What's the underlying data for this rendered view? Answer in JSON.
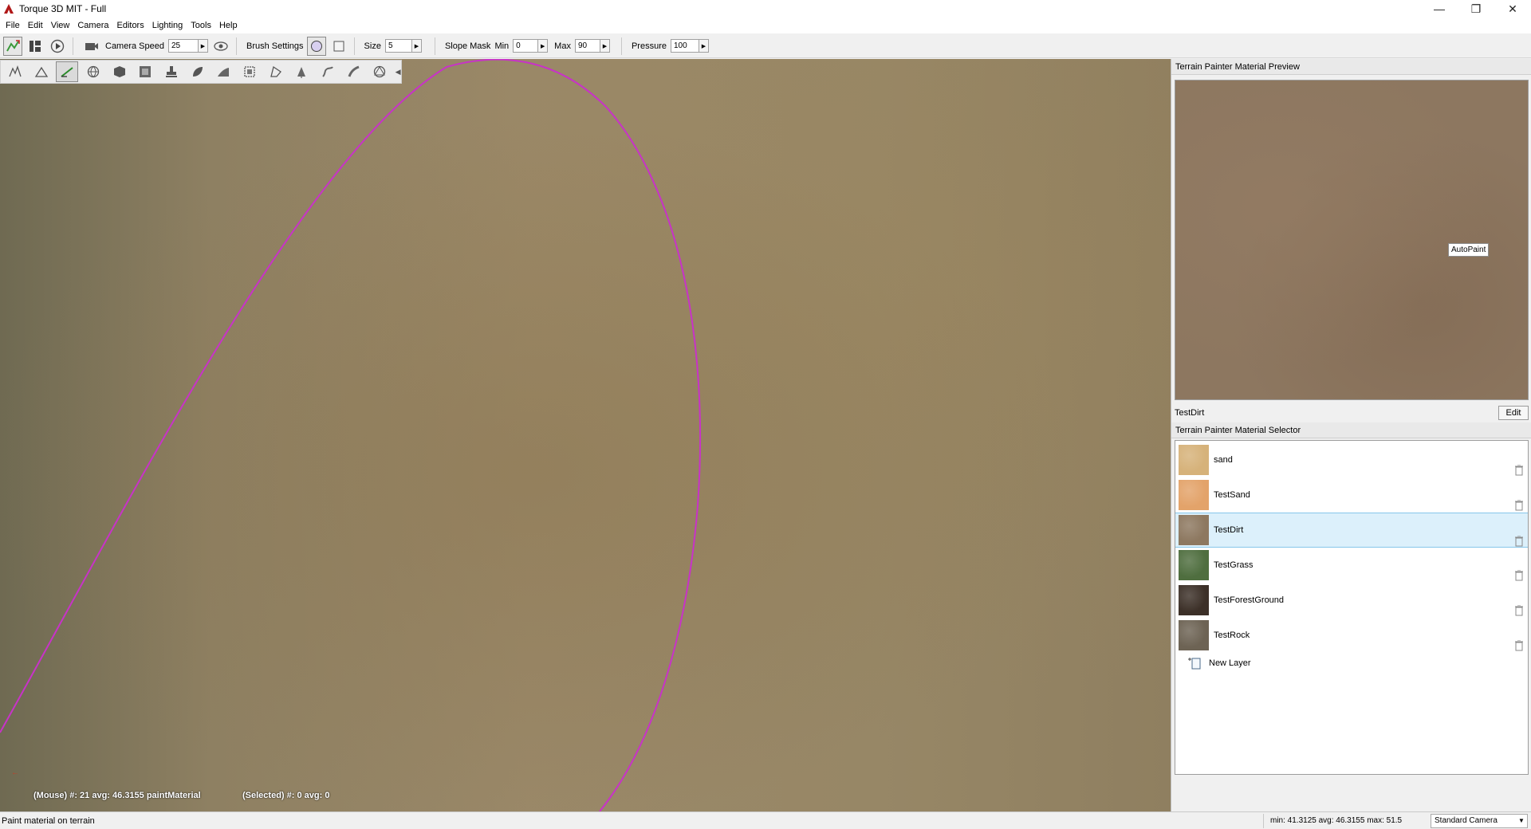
{
  "window": {
    "title": "Torque 3D MIT - Full",
    "controls": [
      "minimize",
      "maximize",
      "close"
    ]
  },
  "menu": [
    "File",
    "Edit",
    "View",
    "Camera",
    "Editors",
    "Lighting",
    "Tools",
    "Help"
  ],
  "toolbar": {
    "camera_speed_label": "Camera Speed",
    "camera_speed_value": "25",
    "brush_settings_label": "Brush Settings",
    "size_label": "Size",
    "size_value": "5",
    "slope_mask_label": "Slope Mask",
    "min_label": "Min",
    "min_value": "0",
    "max_label": "Max",
    "max_value": "90",
    "pressure_label": "Pressure",
    "pressure_value": "100"
  },
  "palette": {
    "tools": [
      "terrain-raise-icon",
      "terrain-height-icon",
      "terrain-paint-icon",
      "globe-icon",
      "cube-icon",
      "texture-icon",
      "stamp-icon",
      "leaf-icon",
      "ramp-icon",
      "bounds-icon",
      "shape-icon",
      "forest-icon",
      "river-icon",
      "road-icon",
      "navmesh-icon"
    ],
    "active_index": 2
  },
  "viewport": {
    "mouse_info": "(Mouse) #: 21  avg: 46.3155 paintMaterial",
    "selected_info": "(Selected) #: 0  avg: 0"
  },
  "preview_panel": {
    "title": "Terrain Painter Material Preview",
    "autopaint_label": "AutoPaint",
    "material_name": "TestDirt",
    "edit_label": "Edit"
  },
  "selector_panel": {
    "title": "Terrain Painter Material Selector",
    "materials": [
      {
        "name": "sand",
        "color": "#d6b27a"
      },
      {
        "name": "TestSand",
        "color": "#e3a36a"
      },
      {
        "name": "TestDirt",
        "color": "#8d7860"
      },
      {
        "name": "TestGrass",
        "color": "#4f6e3f"
      },
      {
        "name": "TestForestGround",
        "color": "#3c3028"
      },
      {
        "name": "TestRock",
        "color": "#6d6354"
      }
    ],
    "selected_index": 2,
    "new_layer_label": "New Layer"
  },
  "statusbar": {
    "message": "Paint material on terrain",
    "stats": "min: 41.3125  avg: 46.3155  max: 51.5",
    "camera": "Standard Camera"
  },
  "colors": {
    "brush_outline": "#c832c8",
    "selection_bg": "#dcf0fb"
  }
}
